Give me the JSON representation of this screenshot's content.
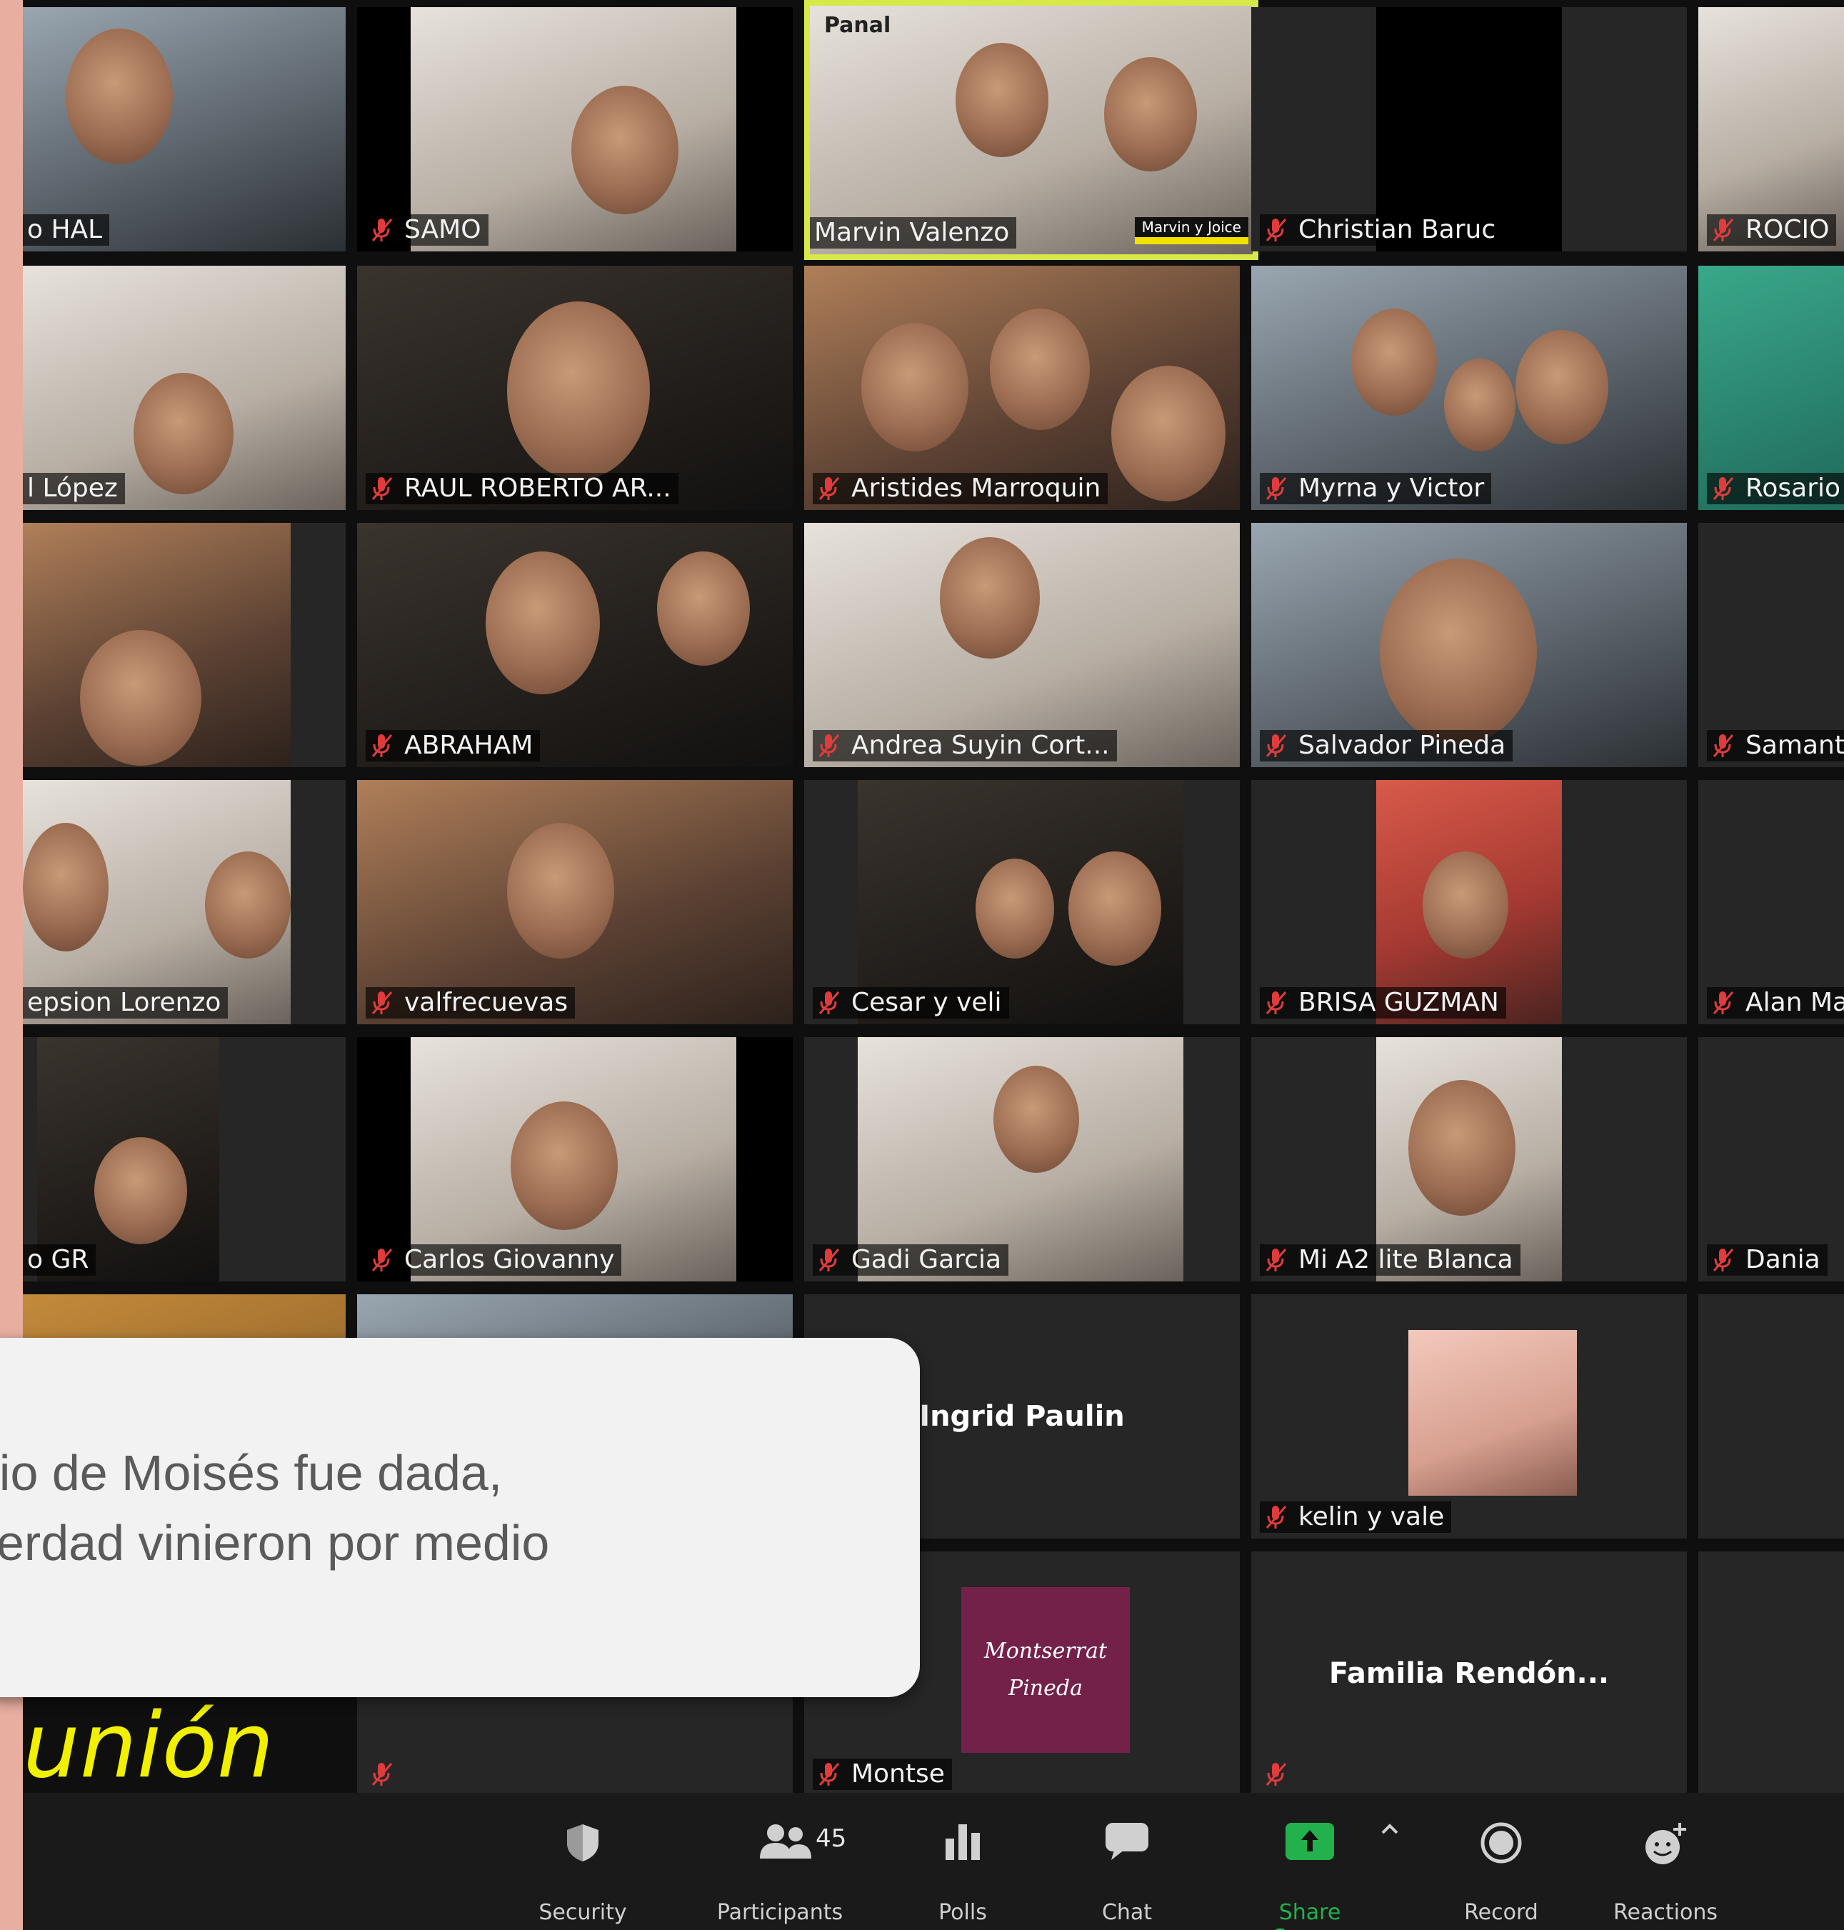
{
  "participants": [
    {
      "name": "o HAL",
      "muted": false
    },
    {
      "name": "SAMO",
      "muted": true
    },
    {
      "name": "Marvin Valenzo",
      "muted": false,
      "logo": "Panal",
      "tag": "Marvin y Joice"
    },
    {
      "name": "Christian Baruc",
      "muted": true
    },
    {
      "name": "ROCIO",
      "muted": true
    },
    {
      "name": "l López",
      "muted": false
    },
    {
      "name": "RAUL ROBERTO AR...",
      "muted": true
    },
    {
      "name": "Aristides Marroquin",
      "muted": true
    },
    {
      "name": "Myrna y Victor",
      "muted": true
    },
    {
      "name": "Rosario",
      "muted": true
    },
    {
      "name": "",
      "muted": false
    },
    {
      "name": "ABRAHAM",
      "muted": true
    },
    {
      "name": "Andrea Suyin Cort...",
      "muted": true
    },
    {
      "name": "Salvador Pineda",
      "muted": true
    },
    {
      "name": "Samanth",
      "muted": true
    },
    {
      "name": "epsion Lorenzo",
      "muted": false
    },
    {
      "name": "valfrecuevas",
      "muted": true
    },
    {
      "name": "Cesar y veli",
      "muted": true
    },
    {
      "name": "BRISA GUZMAN",
      "muted": true
    },
    {
      "name": "Alan Ma",
      "muted": true
    },
    {
      "name": "o GR",
      "muted": false
    },
    {
      "name": "Carlos Giovanny",
      "muted": true
    },
    {
      "name": "Gadi Garcia",
      "muted": true
    },
    {
      "name": "Mi A2 lite Blanca",
      "muted": true
    },
    {
      "name": "Dania",
      "muted": true
    },
    {
      "name": "Ingrid Paulin",
      "muted": false,
      "center": true
    },
    {
      "name": "kelin y vale",
      "muted": true
    },
    {
      "name": "",
      "muted": true
    },
    {
      "name": "Montse",
      "muted": true,
      "avatar_text_1": "Montserrat",
      "avatar_text_2": "Pineda"
    },
    {
      "name": "Familia Rendón...",
      "muted": true,
      "center": true
    }
  ],
  "overlay": {
    "line1": "dio de Moisés fue dada,",
    "line2": "verdad vinieron por medio"
  },
  "slide_text": "unión",
  "toolbar": {
    "participants_count": "45",
    "items": [
      "Security",
      "Participants",
      "Polls",
      "Chat",
      "Share Screen",
      "Record",
      "Reactions"
    ]
  },
  "colors": {
    "active_speaker": "#d6e84a",
    "share_green": "#22b14c",
    "muted_red": "#e03c3c",
    "slide_text": "#f0f000"
  }
}
